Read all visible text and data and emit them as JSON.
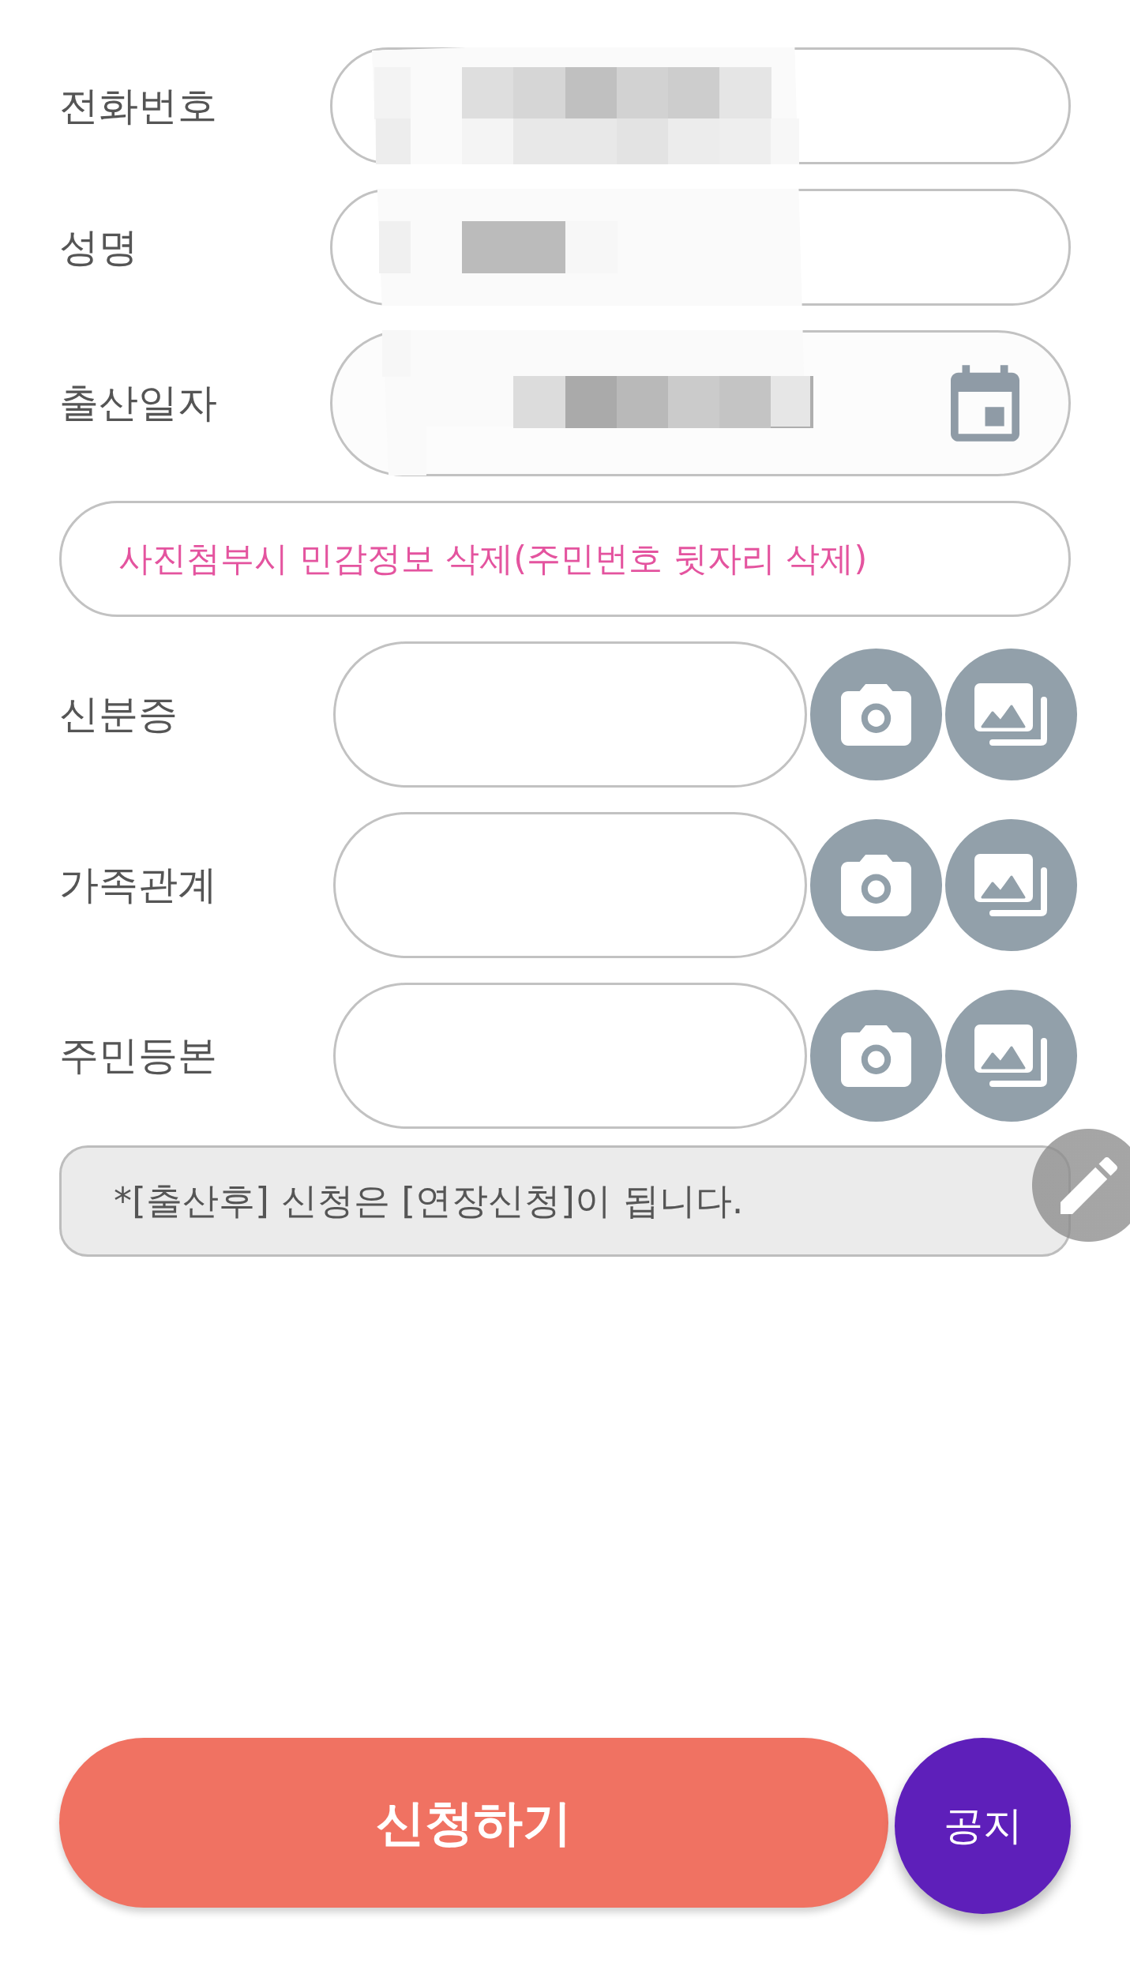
{
  "fields": [
    {
      "label": "전화번호",
      "kind": "text",
      "redacted": true
    },
    {
      "label": "성명",
      "kind": "text",
      "redacted": true
    },
    {
      "label": "출산일자",
      "kind": "date",
      "redacted": true
    }
  ],
  "notice": {
    "text": "사진첨부시 민감정보 삭제(주민번호 뒷자리 삭제)"
  },
  "attachments": [
    {
      "label": "신분증"
    },
    {
      "label": "가족관계"
    },
    {
      "label": "주민등본"
    }
  ],
  "note": {
    "text": "*[출산후] 신청은 [연장신청]이 됩니다."
  },
  "submit_button": {
    "label": "신청하기"
  },
  "notice_button": {
    "label": "공지"
  }
}
